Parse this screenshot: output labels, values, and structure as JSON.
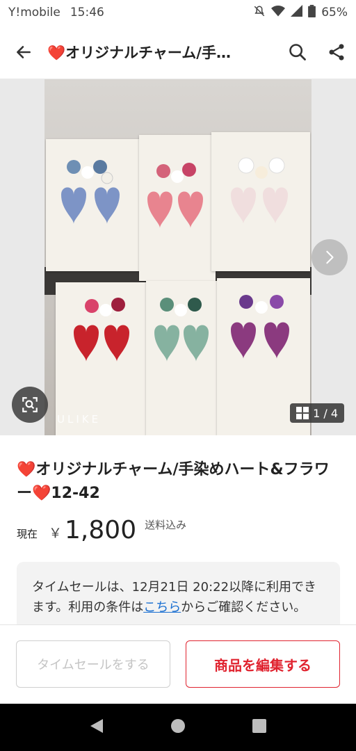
{
  "status_bar": {
    "carrier": "Y!mobile",
    "time": "15:46",
    "battery": "65%",
    "icons": [
      "mute-icon",
      "wifi-icon",
      "signal-icon",
      "battery-icon"
    ]
  },
  "app_bar": {
    "title": "❤️オリジナルチャーム/手…",
    "icons": [
      "back-arrow-icon",
      "search-icon",
      "share-icon"
    ]
  },
  "gallery": {
    "watermark": "ULIKE",
    "counter": "1 / 4",
    "icons": [
      "chevron-right-icon",
      "zoom-search-icon",
      "grid-icon"
    ]
  },
  "item": {
    "title": "❤️オリジナルチャーム/手染めハート&フラワー❤️12-42",
    "price_label": "現在",
    "currency": "￥",
    "price": "1,800",
    "shipping": "送料込み"
  },
  "notice": {
    "text_before": "タイムセールは、12月21日 20:22以降に利用できます。利用の条件は",
    "link": "こちら",
    "text_after": "からご確認ください。"
  },
  "actions": {
    "time_sale": "タイムセールをする",
    "edit": "商品を編集する"
  },
  "colors": {
    "accent": "#e0232f",
    "link": "#1a6fd1"
  }
}
